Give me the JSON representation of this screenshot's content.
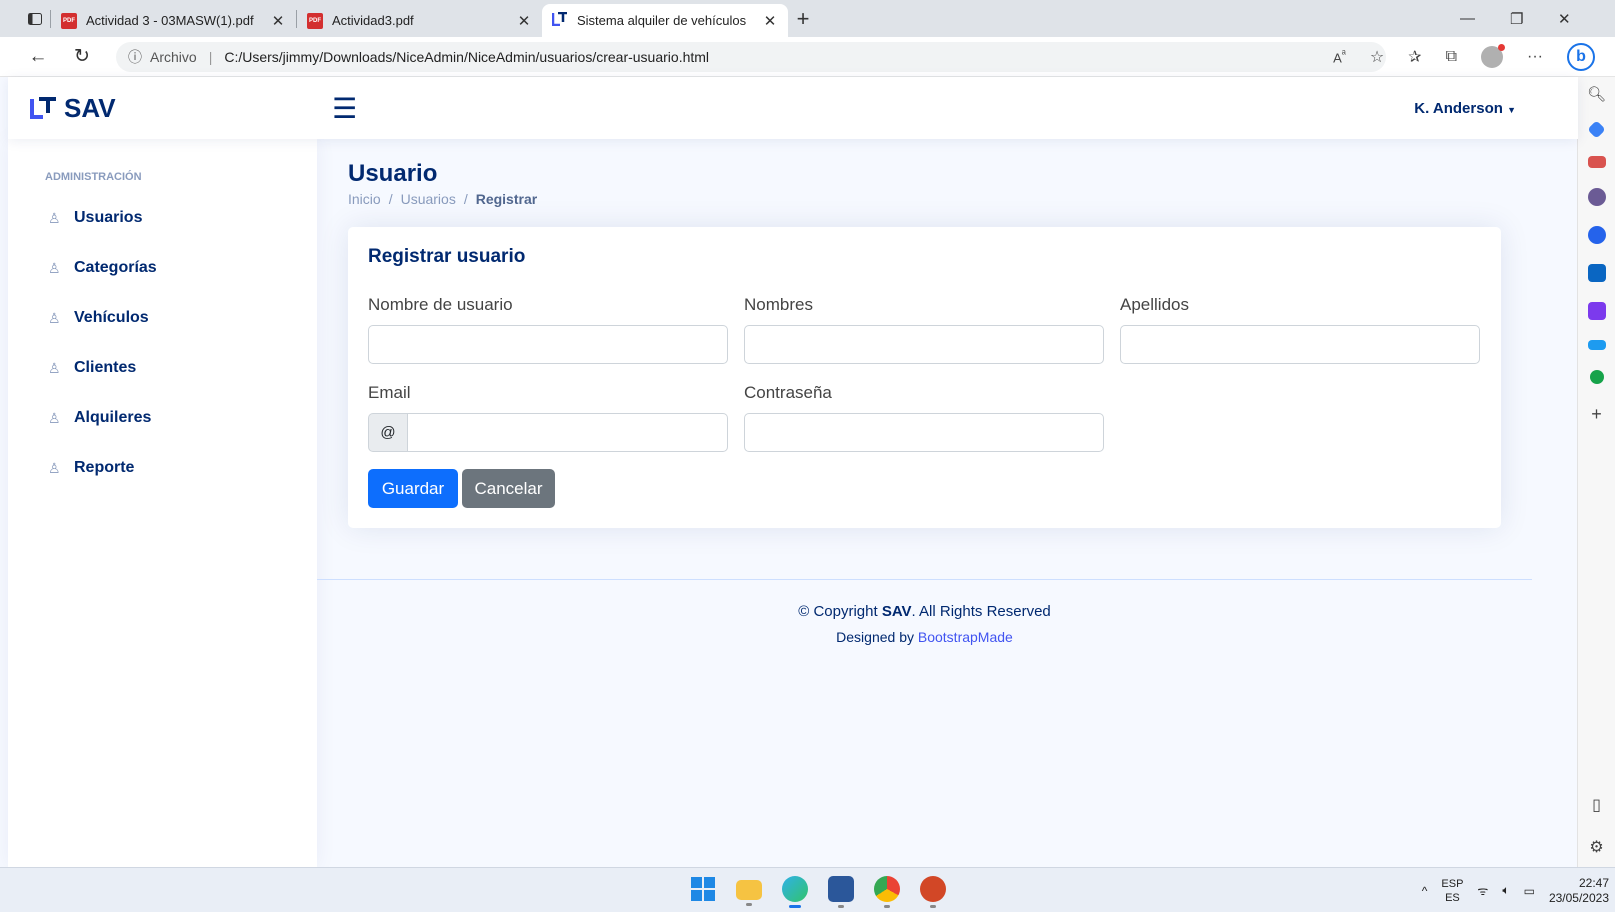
{
  "browser": {
    "tabs": [
      {
        "title": "Actividad 3 - 03MASW(1).pdf",
        "icon": "pdf-icon",
        "active": false
      },
      {
        "title": "Actividad3.pdf",
        "icon": "pdf-icon",
        "active": false
      },
      {
        "title": "Sistema alquiler de vehículos",
        "icon": "sav-logo-icon",
        "active": true
      }
    ],
    "new_tab": "+",
    "address_prefix": "Archivo",
    "url": "C:/Users/jimmy/Downloads/NiceAdmin/NiceAdmin/usuarios/crear-usuario.html"
  },
  "header": {
    "logo_text": "SAV",
    "profile_name": "K. Anderson"
  },
  "sidebar": {
    "heading": "ADMINISTRACIÓN",
    "items": [
      {
        "label": "Usuarios"
      },
      {
        "label": "Categorías"
      },
      {
        "label": "Vehículos"
      },
      {
        "label": "Clientes"
      },
      {
        "label": "Alquileres"
      },
      {
        "label": "Reporte"
      }
    ]
  },
  "page": {
    "title": "Usuario",
    "breadcrumb": [
      "Inicio",
      "Usuarios",
      "Registrar"
    ],
    "separator": "/"
  },
  "form": {
    "card_title": "Registrar usuario",
    "labels": {
      "username": "Nombre de usuario",
      "nombres": "Nombres",
      "apellidos": "Apellidos",
      "email": "Email",
      "password": "Contraseña"
    },
    "values": {
      "username": "",
      "nombres": "",
      "apellidos": "",
      "email": "",
      "password": ""
    },
    "email_addon": "@",
    "save_label": "Guardar",
    "cancel_label": "Cancelar"
  },
  "footer": {
    "copyright_prefix": "© Copyright",
    "brand": "SAV",
    "copyright_suffix": ". All Rights Reserved",
    "designed_by": "Designed by",
    "designer_link": "BootstrapMade"
  },
  "taskbar": {
    "lang_top": "ESP",
    "lang_bottom": "ES",
    "time": "22:47",
    "date": "23/05/2023"
  },
  "colors": {
    "brand_navy": "#012970",
    "primary_button": "#0d6efd",
    "secondary_button": "#6c757d",
    "link": "#4154f1",
    "muted": "#899bbd"
  }
}
